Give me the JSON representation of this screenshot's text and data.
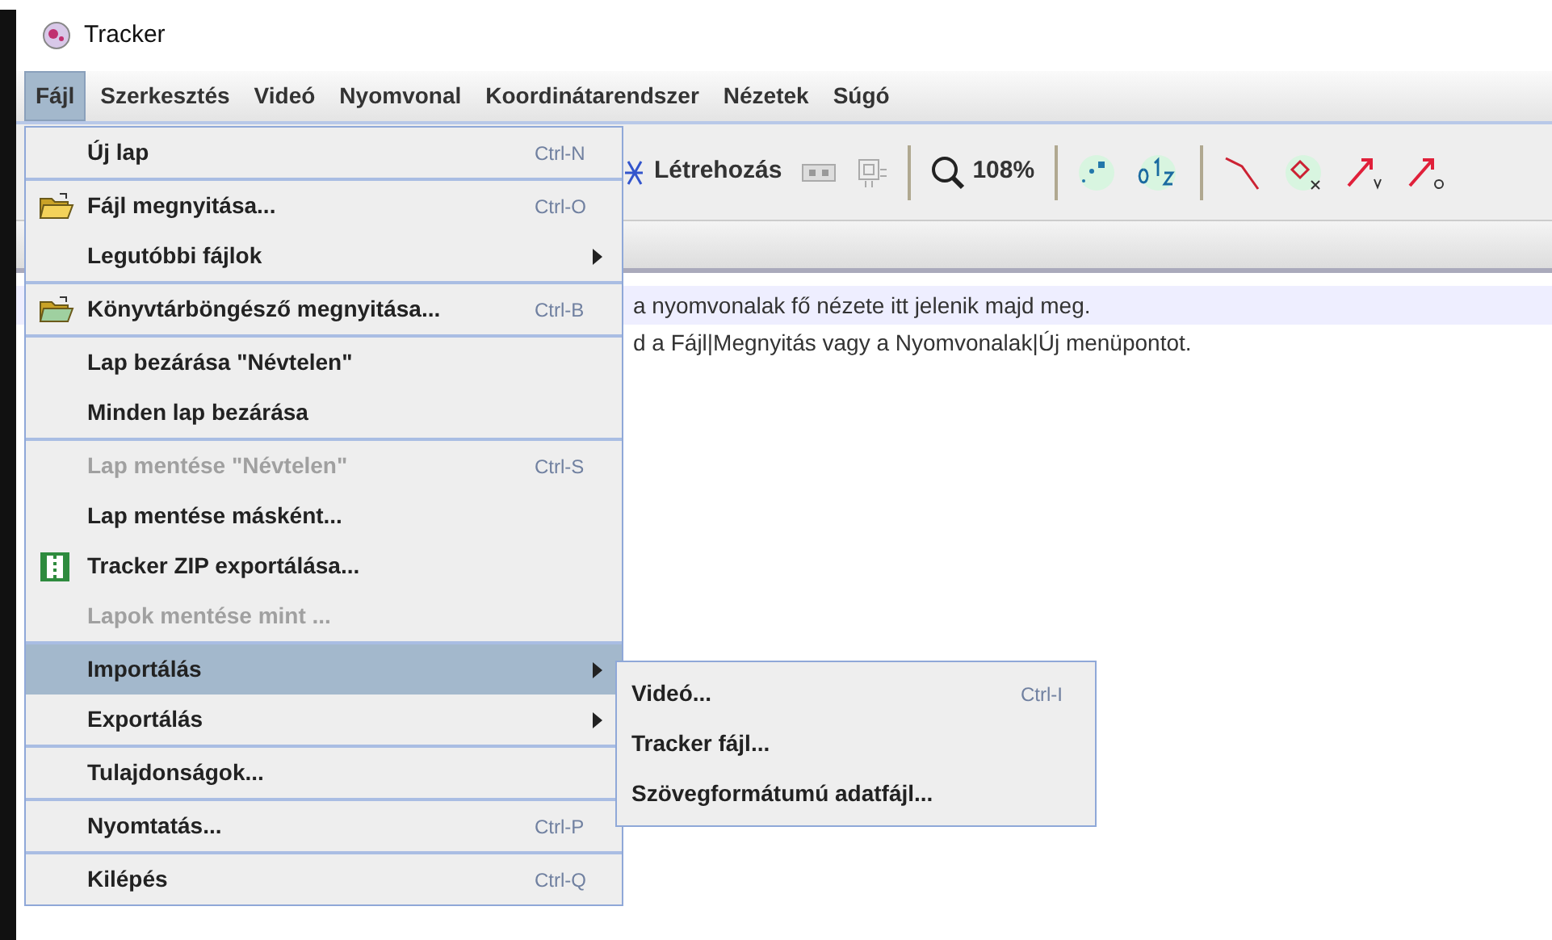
{
  "window": {
    "title": "Tracker"
  },
  "menubar": [
    {
      "label": "Fájl",
      "selected": true
    },
    {
      "label": "Szerkesztés",
      "selected": false
    },
    {
      "label": "Videó",
      "selected": false
    },
    {
      "label": "Nyomvonal",
      "selected": false
    },
    {
      "label": "Koordinátarendszer",
      "selected": false
    },
    {
      "label": "Nézetek",
      "selected": false
    },
    {
      "label": "Súgó",
      "selected": false
    }
  ],
  "toolbar": {
    "create_label": "Létrehozás",
    "zoom": "108%"
  },
  "hint_lines": [
    "a nyomvonalak fő nézete itt jelenik majd meg.",
    "d a Fájl|Megnyitás vagy a Nyomvonalak|Új menüpontot."
  ],
  "file_menu": [
    [
      {
        "label": "Új lap",
        "shortcut": "Ctrl-N",
        "disabled": false,
        "selected": false,
        "submenu": false
      }
    ],
    [
      {
        "label": "Fájl megnyitása...",
        "shortcut": "Ctrl-O",
        "disabled": false,
        "selected": false,
        "submenu": false,
        "kind": "folder"
      },
      {
        "label": "Legutóbbi fájlok",
        "disabled": false,
        "selected": false,
        "submenu": true
      }
    ],
    [
      {
        "label": "Könyvtárböngésző megnyitása...",
        "shortcut": "Ctrl-B",
        "disabled": false,
        "selected": false,
        "submenu": false,
        "kind": "library"
      }
    ],
    [
      {
        "label": "Lap bezárása \"Névtelen\"",
        "disabled": false,
        "selected": false,
        "submenu": false
      },
      {
        "label": "Minden lap bezárása",
        "disabled": false,
        "selected": false,
        "submenu": false
      }
    ],
    [
      {
        "label": "Lap mentése \"Névtelen\"",
        "shortcut": "Ctrl-S",
        "disabled": true,
        "selected": false,
        "submenu": false
      },
      {
        "label": "Lap mentése másként...",
        "disabled": false,
        "selected": false,
        "submenu": false
      },
      {
        "label": "Tracker ZIP exportálása...",
        "disabled": false,
        "selected": false,
        "submenu": false,
        "kind": "zip"
      },
      {
        "label": "Lapok mentése mint ...",
        "disabled": true,
        "selected": false,
        "submenu": false
      }
    ],
    [
      {
        "label": "Importálás",
        "disabled": false,
        "selected": true,
        "submenu": true
      },
      {
        "label": "Exportálás",
        "disabled": false,
        "selected": false,
        "submenu": true
      }
    ],
    [
      {
        "label": "Tulajdonságok...",
        "disabled": false,
        "selected": false,
        "submenu": false
      }
    ],
    [
      {
        "label": "Nyomtatás...",
        "shortcut": "Ctrl-P",
        "disabled": false,
        "selected": false,
        "submenu": false
      }
    ],
    [
      {
        "label": "Kilépés",
        "shortcut": "Ctrl-Q",
        "disabled": false,
        "selected": false,
        "submenu": false
      }
    ]
  ],
  "import_submenu": [
    {
      "label": "Videó...",
      "shortcut": "Ctrl-I"
    },
    {
      "label": "Tracker fájl..."
    },
    {
      "label": "Szövegformátumú adatfájl..."
    }
  ]
}
